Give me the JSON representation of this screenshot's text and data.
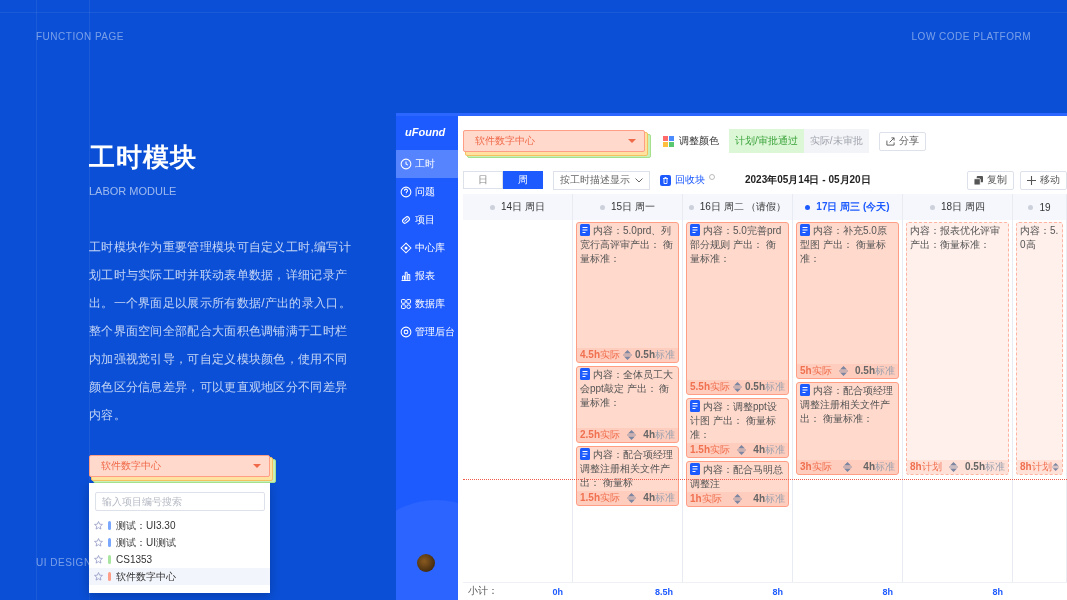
{
  "top_left_label": "FUNCTION PAGE",
  "top_right_label": "LOW CODE PLATFORM",
  "bottom_left_label": "UI DESIGN",
  "intro": {
    "title": "工时模块",
    "subtitle": "LABOR MODULE",
    "description": "工时模块作为重要管理模块可自定义工时,编写计划工时与实际工时并联动表单数据，详细记录产出。一个界面足以展示所有数据/产出的录入口。整个界面空间全部配合大面积色调铺满于工时栏内加强视觉引导，可自定义模块颜色，使用不同颜色区分信息差异，可以更直观地区分不同差异内容。"
  },
  "project_picker_demo": {
    "value": "软件数字中心",
    "search_placeholder": "输入项目编号搜索",
    "options": [
      {
        "label": "测试：UI3.30",
        "color": "#7aa7ff",
        "selected": false
      },
      {
        "label": "测试：UI测试",
        "color": "#7aa7ff",
        "selected": false
      },
      {
        "label": "CS1353",
        "color": "#a8e6a0",
        "selected": false
      },
      {
        "label": "软件数字中心",
        "color": "#ff9f8a",
        "selected": true
      }
    ]
  },
  "app": {
    "logo": "uFound",
    "sidebar": [
      {
        "label": "工时",
        "selected": true
      },
      {
        "label": "问题",
        "selected": false
      },
      {
        "label": "项目",
        "selected": false
      },
      {
        "label": "中心库",
        "selected": false
      },
      {
        "label": "报表",
        "selected": false
      },
      {
        "label": "数据库",
        "selected": false
      },
      {
        "label": "管理后台",
        "selected": false
      }
    ],
    "project": "软件数字中心",
    "adjust_color": "调整颜色",
    "legend": [
      {
        "label": "计划/审批通过",
        "kind": "plan"
      },
      {
        "label": "实际/未审批",
        "kind": "actual"
      }
    ],
    "share": "分享",
    "view_tabs": [
      {
        "label": "日",
        "selected": false
      },
      {
        "label": "周",
        "selected": true
      }
    ],
    "display_mode": "按工时描述显示",
    "recycle": "回收块",
    "date_range": "2023年05月14日 - 05月20日",
    "actions": [
      "复制",
      "移动"
    ],
    "subtotal_label": "小计：",
    "days": [
      {
        "label": "14日 周日",
        "today": false,
        "subtotal": "0h"
      },
      {
        "label": "15日 周一",
        "today": false,
        "subtotal": "8.5h",
        "entries": [
          {
            "kind": "actual",
            "content": "内容：5.0prd、列宽行高评审产出： 衡量标准：",
            "hours": "4.5h",
            "hours_label": "实际",
            "standard": "0.5h",
            "standard_label": "标准"
          },
          {
            "kind": "actual",
            "content": "内容：全体员工大会ppt敲定 产出： 衡量标准：",
            "hours": "2.5h",
            "hours_label": "实际",
            "standard": "4h",
            "standard_label": "标准"
          },
          {
            "kind": "actual",
            "content": "内容：配合项经理调整注册相关文件产出： 衡量标",
            "hours": "1.5h",
            "hours_label": "实际",
            "standard": "4h",
            "standard_label": "标准"
          }
        ]
      },
      {
        "label": "16日 周二 （请假）",
        "today": false,
        "subtotal": "8h",
        "entries": [
          {
            "kind": "actual",
            "content": "内容：5.0完善prd部分规则 产出： 衡量标准：",
            "hours": "5.5h",
            "hours_label": "实际",
            "standard": "0.5h",
            "standard_label": "标准"
          },
          {
            "kind": "actual",
            "content": "内容：调整ppt设计图 产出： 衡量标准：",
            "hours": "1.5h",
            "hours_label": "实际",
            "standard": "4h",
            "standard_label": "标准"
          },
          {
            "kind": "actual",
            "content": "内容：配合马明总调整注",
            "hours": "1h",
            "hours_label": "实际",
            "standard": "4h",
            "standard_label": "标准"
          }
        ]
      },
      {
        "label": "17日 周三 (今天)",
        "today": true,
        "subtotal": "8h",
        "entries": [
          {
            "kind": "actual",
            "content": "内容：补充5.0原型图 产出： 衡量标准：",
            "hours": "5h",
            "hours_label": "实际",
            "standard": "0.5h",
            "standard_label": "标准"
          },
          {
            "kind": "actual",
            "content": "内容：配合项经理调整注册相关文件产出： 衡量标准：",
            "hours": "3h",
            "hours_label": "实际",
            "standard": "4h",
            "standard_label": "标准"
          }
        ]
      },
      {
        "label": "18日 周四",
        "today": false,
        "subtotal": "8h",
        "entries": [
          {
            "kind": "plan",
            "content": "内容：报表优化评审产出：衡量标准：",
            "hours": "8h",
            "hours_label": "计划",
            "standard": "0.5h",
            "standard_label": "标准"
          }
        ]
      },
      {
        "label": "19",
        "today": false,
        "entries": [
          {
            "kind": "plan",
            "content": "内容：5.0高",
            "hours": "8h",
            "hours_label": "计划"
          }
        ]
      }
    ]
  }
}
